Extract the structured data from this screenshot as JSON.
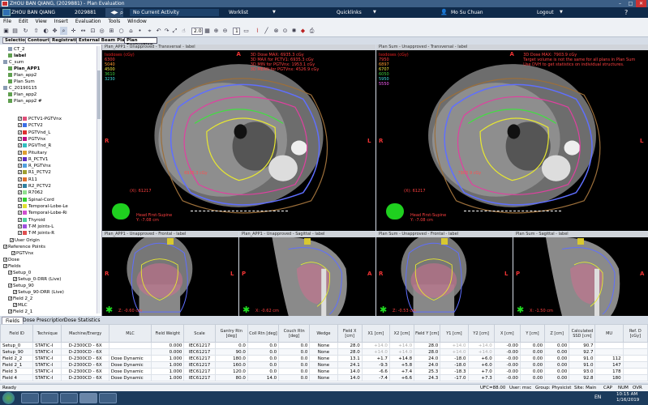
{
  "window": {
    "title": "ZHOU BAN QIANG, (2029881) - Plan Evaluation",
    "min": "–",
    "max": "□",
    "close": "✕"
  },
  "topbar": {
    "patient": "ZHOU BAN QIANG",
    "id": "2029881",
    "activity": "No Current Activity",
    "worklist": "Worklist",
    "quicklinks": "Quicklinks",
    "user": "Mo Su Chuan",
    "logout": "Logout"
  },
  "menu": [
    "File",
    "Edit",
    "View",
    "Insert",
    "Evaluation",
    "Tools",
    "Window"
  ],
  "toolbar": {
    "zoom1": "2.0",
    "zoom2": "2.0",
    "page": "1"
  },
  "workspace_tabs": [
    "Selection",
    "Contouring",
    "Registration",
    "External Beam Planning",
    "Plan Evaluation"
  ],
  "tree": [
    {
      "label": "CT_2",
      "bold": false
    },
    {
      "label": "label",
      "bold": true
    },
    {
      "label": "C_sum",
      "bold": false
    },
    {
      "label": "Plan_APP1",
      "bold": true
    },
    {
      "label": "Plan_app2",
      "bold": false
    },
    {
      "label": "Plan Sum",
      "bold": false
    },
    {
      "label": "C_20190115",
      "bold": false
    },
    {
      "label": "Plan_app2",
      "bold": false
    },
    {
      "label": "Plan_app2 #",
      "bold": false
    }
  ],
  "structures": [
    {
      "label": "PCTV1-PGTVnx",
      "color": "#e0507a"
    },
    {
      "label": "PCTV2",
      "color": "#3a6ee8"
    },
    {
      "label": "PGTVnd_L",
      "color": "#e03030"
    },
    {
      "label": "PGTVnx",
      "color": "#c01080"
    },
    {
      "label": "PGVTnd_R",
      "color": "#30c0c0"
    },
    {
      "label": "Pituitary",
      "color": "#e0a030"
    },
    {
      "label": "R_PCTV1",
      "color": "#6030c0"
    },
    {
      "label": "R_PGTVnx",
      "color": "#50a0e0"
    },
    {
      "label": "R1_PCTV2",
      "color": "#a0a030"
    },
    {
      "label": "R11",
      "color": "#e07030"
    },
    {
      "label": "R2_PCTV2",
      "color": "#3080a0"
    },
    {
      "label": "R7062",
      "color": "#90e090"
    },
    {
      "label": "Spinal-Cord",
      "color": "#30d030"
    },
    {
      "label": "Temporal-Lobe-Le",
      "color": "#e0e030"
    },
    {
      "label": "Temporal-Lobe-Ri",
      "color": "#d050d0"
    },
    {
      "label": "Thyroid",
      "color": "#50d0a0"
    },
    {
      "label": "T-M joints-L",
      "color": "#a050e0"
    },
    {
      "label": "T-M joints-R",
      "color": "#e05050"
    }
  ],
  "tree2": [
    "User Origin",
    "Reference Points",
    "PGTVnx",
    "Dose",
    "Fields",
    "Setup_0",
    "Setup_0-DRR (Live)",
    "Setup_90",
    "Setup_90-DRR (Live)",
    "Field 2_2",
    "MLC",
    "Field 2_1"
  ],
  "viewports": {
    "v1": {
      "header": "Plan_APP1 - Unapproved - Transversal - label",
      "iso": "Isodoses (cGy)",
      "lines": [
        "6300",
        "5040",
        "4500",
        "3610",
        "3230"
      ],
      "info": [
        "3D Dose MAX: 6935.3 cGy",
        "3D MAX for PCTV1: 6935.3 cGy",
        "3D MIN for PGTVnx: 1953.1 cGy",
        "3D MEAN for PGTVnx: 4526.9 cGy"
      ],
      "dose": "6935.3 cGy",
      "coord": "(X): 61217",
      "hfs": "Head First-Supine",
      "y": "Y: -7.08 cm"
    },
    "v2": {
      "header": "Plan Sum - Unapproved - Transversal - label",
      "iso": "Isodoses (cGy)",
      "lines": [
        "7950",
        "6897",
        "6707",
        "6050",
        "5950",
        "5550"
      ],
      "info": [
        "3D Dose MAX: 7903.9 cGy",
        "Target volume is not the same for all plans in Plan Sum",
        "Use DVH to get statistics on individual structures."
      ],
      "dose": "7903.9 cGy",
      "coord": "(X): 61217",
      "hfs": "Head First-Supine",
      "y": "Y: -7.08 cm"
    },
    "v3": {
      "header": "Plan_APP1 - Unapproved - Frontal - label",
      "z": "Z: -0.60 cm"
    },
    "v4": {
      "header": "Plan_APP1 - Unapproved - Sagittal - label",
      "x": "X: -0.62 cm"
    },
    "v5": {
      "header": "Plan Sum - Unapproved - Frontal - label",
      "z": "Z: -0.53 cm"
    },
    "v6": {
      "header": "Plan Sum - Sagittal - label",
      "x": "X: -1.50 cm"
    }
  },
  "orient": {
    "A": "A",
    "R": "R",
    "L": "L",
    "P": "P",
    "H": "H"
  },
  "bottom_tabs": [
    "Fields",
    "Dose Prescription",
    "Dose Statistics"
  ],
  "table": {
    "headers": [
      "Field ID",
      "Technique",
      "Machine/Energy",
      "MLC",
      "Field Weight",
      "Scale",
      "Gantry Rtn [deg]",
      "Coll Rtn [deg]",
      "Couch Rtn [deg]",
      "Wedge",
      "Field X [cm]",
      "X1 [cm]",
      "X2 [cm]",
      "Field Y [cm]",
      "Y1 [cm]",
      "Y2 [cm]",
      "X [cm]",
      "Y [cm]",
      "Z [cm]",
      "Calculated SSD [cm]",
      "MU",
      "Ref. D [cGy]"
    ],
    "rows": [
      [
        "Setup_0",
        "STATIC-I",
        "D-2300CD - 6X",
        "",
        "0.000",
        "IEC61217",
        "0.0",
        "0.0",
        "0.0",
        "None",
        "28.0",
        "+14.0",
        "+14.0",
        "28.0",
        "+14.0",
        "+14.0",
        "-0.00",
        "0.00",
        "0.00",
        "90.7",
        "",
        ""
      ],
      [
        "Setup_90",
        "STATIC-I",
        "D-2300CD - 6X",
        "",
        "0.000",
        "IEC61217",
        "90.0",
        "0.0",
        "0.0",
        "None",
        "28.0",
        "+14.0",
        "+14.0",
        "28.0",
        "+14.0",
        "+14.0",
        "-0.00",
        "0.00",
        "0.00",
        "92.7",
        "",
        ""
      ],
      [
        "Field 2_2",
        "STATIC-I",
        "D-2300CD - 6X",
        "Dose Dynamic",
        "1.000",
        "IEC61217",
        "180.0",
        "0.0",
        "0.0",
        "None",
        "13.1",
        "+1.7",
        "+14.8",
        "24.0",
        "-18.0",
        "+6.0",
        "-0.00",
        "0.00",
        "0.00",
        "91.0",
        "112",
        ""
      ],
      [
        "Field 2_1",
        "STATIC-I",
        "D-2300CD - 6X",
        "Dose Dynamic",
        "1.000",
        "IEC61217",
        "160.0",
        "0.0",
        "0.0",
        "None",
        "24.1",
        "-9.3",
        "+5.8",
        "24.0",
        "-18.0",
        "+6.0",
        "-0.00",
        "0.00",
        "0.00",
        "91.0",
        "147",
        ""
      ],
      [
        "Field 3",
        "STATIC-I",
        "D-2300CD - 6X",
        "Dose Dynamic",
        "1.000",
        "IEC61217",
        "120.0",
        "0.0",
        "0.0",
        "None",
        "14.0",
        "-6.6",
        "+7.4",
        "25.3",
        "-18.3",
        "+7.0",
        "-0.00",
        "0.00",
        "0.00",
        "93.0",
        "178",
        ""
      ],
      [
        "Field 4",
        "STATIC-I",
        "D-2300CD - 6X",
        "Dose Dynamic",
        "1.000",
        "IEC61217",
        "80.0",
        "14.0",
        "0.0",
        "None",
        "14.0",
        "-7.4",
        "+6.6",
        "24.3",
        "-17.0",
        "+7.3",
        "-0.00",
        "0.00",
        "0.00",
        "92.8",
        "180",
        ""
      ]
    ]
  },
  "status": {
    "ready": "Ready",
    "uc": "UFC=88.00",
    "user": "User: msc",
    "group": "Group: Physicist",
    "site": "Site: Main",
    "caps": "CAP",
    "num": "NUM",
    "ovr": "OVR"
  },
  "taskbar": {
    "lang": "EN",
    "time": "10:15 AM",
    "date": "1/16/2019"
  },
  "colors": {
    "titlebar": "#3c5f86",
    "topbar": "#0f2a4a",
    "accent": "#cc2b2b"
  }
}
